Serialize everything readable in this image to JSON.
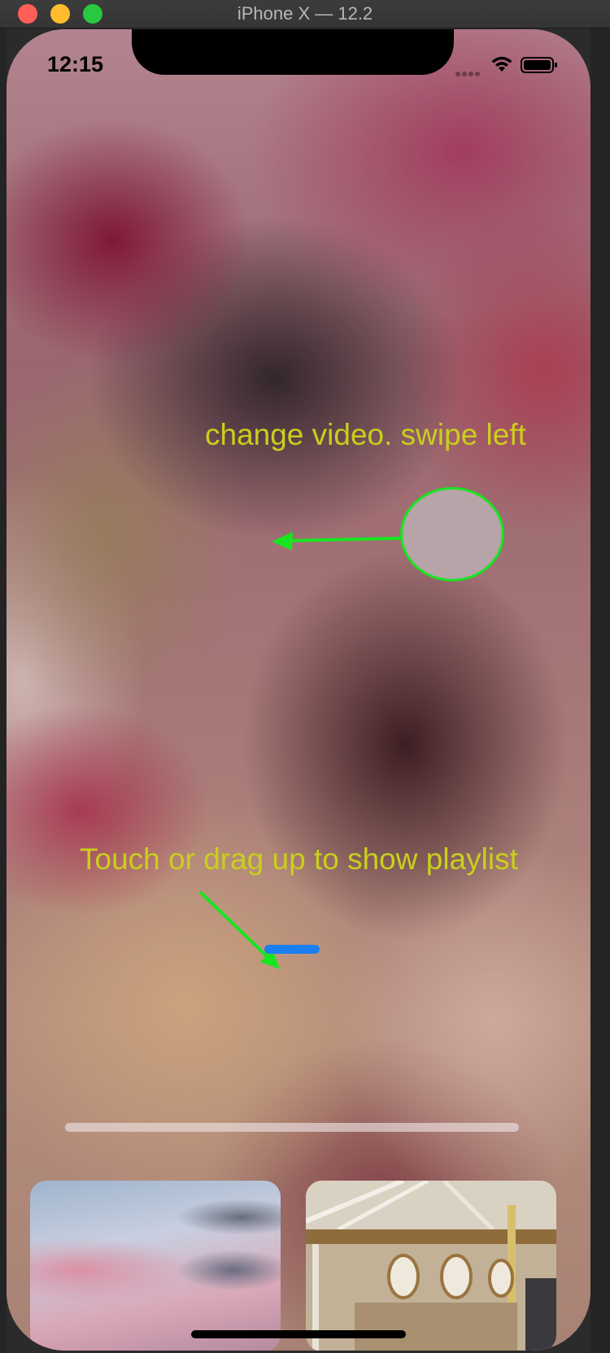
{
  "window": {
    "title": "iPhone X — 12.2"
  },
  "status_bar": {
    "time": "12:15",
    "icons": [
      "cellular-dots-icon",
      "wifi-icon",
      "battery-icon"
    ]
  },
  "annotations": {
    "swipe_text": "change video. swipe left",
    "playlist_text": "Touch or drag up to show playlist"
  },
  "colors": {
    "annotation_text": "#c9cf1c",
    "annotation_stroke": "#18e520",
    "playlist_handle": "#1b7ff0"
  },
  "playlist": {
    "thumbnails": [
      "sky-thumbnail",
      "carousel-thumbnail"
    ]
  }
}
